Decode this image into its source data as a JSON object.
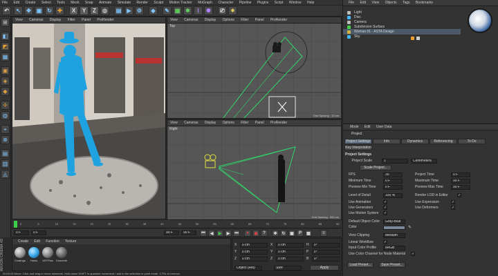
{
  "menubar": {
    "items": [
      "File",
      "Edit",
      "Create",
      "Select",
      "Tools",
      "Mesh",
      "Snap",
      "Animate",
      "Simulate",
      "Render",
      "Sculpt",
      "Motion Tracker",
      "MoGraph",
      "Character",
      "Pipeline",
      "Plugins",
      "Script",
      "Window",
      "Help"
    ]
  },
  "top_toolbar": {
    "axis_x": "X",
    "axis_y": "Y",
    "axis_z": "Z"
  },
  "viewport_left": {
    "menu": [
      "View",
      "Cameras",
      "Display",
      "Filter",
      "Panel",
      "ProRender"
    ]
  },
  "viewport_top": {
    "menu": [
      "View",
      "Cameras",
      "Display",
      "Options",
      "Filter",
      "Panel",
      "ProRender"
    ],
    "name": "Top",
    "grid_spacing": "Grid Spacing : 10 cm"
  },
  "viewport_right": {
    "menu": [
      "View",
      "Cameras",
      "Display",
      "Options",
      "Filter",
      "Panel",
      "ProRender"
    ],
    "name": "Right",
    "grid_spacing": "Grid Spacing : 500 cm"
  },
  "object_manager": {
    "menu": [
      "File",
      "Edit",
      "View",
      "Objects",
      "Tags",
      "Bookmarks"
    ],
    "objects": [
      {
        "name": "Light",
        "color": "#bbbbbb"
      },
      {
        "name": "Disc",
        "color": "#46b8ff"
      },
      {
        "name": "Camera",
        "color": "#bbbbbb"
      },
      {
        "name": "Subdivision Surface",
        "color": "#46d04a"
      },
      {
        "name": "Woman 01 - ASTA Design",
        "color": "#d0b040"
      },
      {
        "name": "Sky",
        "color": "#46b8ff"
      }
    ]
  },
  "attributes": {
    "menu": [
      "Mode",
      "Edit",
      "User Data"
    ],
    "section": "Project",
    "tabs": [
      "Project Settings",
      "Info",
      "Dynamics",
      "Referencing",
      "To Do"
    ],
    "tab2": "Key Interpolation",
    "heading": "Project Settings",
    "project_scale_label": "Project Scale",
    "project_scale_value": "1",
    "project_scale_unit": "Centimeters",
    "scale_button": "Scale Project...",
    "left_fields": [
      {
        "label": "FPS",
        "value": "30"
      },
      {
        "label": "Minimum Time",
        "value": "0 F"
      },
      {
        "label": "Preview Min Time",
        "value": "0 F"
      }
    ],
    "right_fields": [
      {
        "label": "Project Time",
        "value": "0 F"
      },
      {
        "label": "Maximum Time",
        "value": "90 F"
      },
      {
        "label": "Preview Max Time",
        "value": "90 F"
      }
    ],
    "lod_label": "Level of Detail",
    "lod_value": "100 %",
    "render_lod_label": "Render LOD in Editor",
    "checks_left": [
      "Use Animation",
      "Use Generators",
      "Use Motion System"
    ],
    "checks_right": [
      "Use Expression",
      "Use Deformers"
    ],
    "default_color_label": "Default Object Color",
    "default_color_value": "Gray-Blue",
    "color_label": "Color",
    "view_clipping_label": "View Clipping",
    "view_clipping_value": "Medium",
    "linear_workflow_label": "Linear Workflow",
    "input_color_label": "Input Color Profile",
    "input_color_value": "sRGB",
    "color_channel_label": "Use Color Channel for Node Material",
    "load_preset": "Load Preset...",
    "save_preset": "Save Preset..."
  },
  "timeline": {
    "ticks": [
      "0",
      "5",
      "10",
      "15",
      "20",
      "25",
      "30",
      "35",
      "40",
      "45",
      "50",
      "55",
      "60",
      "65",
      "70",
      "75",
      "80",
      "85",
      "90"
    ],
    "start": "0 F",
    "current": "0 F",
    "end": "90 F",
    "preview_end": "90 F"
  },
  "material_manager": {
    "menu": [
      "Create",
      "Edit",
      "Function",
      "Texture"
    ],
    "materials": [
      {
        "name": "Coatings",
        "color": "#9a9a9a"
      },
      {
        "name": "Halos",
        "color": "#3aa8e8"
      },
      {
        "name": "ASTPlas",
        "color": "#888888"
      },
      {
        "name": "Concrete",
        "color": "#6b6b6b"
      }
    ]
  },
  "coords": {
    "rows": [
      [
        "X",
        "0 cm",
        "X",
        "0 cm",
        "H",
        "0°"
      ],
      [
        "Y",
        "0 cm",
        "Y",
        "0 cm",
        "P",
        "0°"
      ],
      [
        "Z",
        "0 cm",
        "Z",
        "0 cm",
        "B",
        "0°"
      ]
    ],
    "apply": "Apply",
    "mode": "Object (Rel)",
    "size": "Size"
  },
  "status": {
    "text": "00:00:05  Move: Click and drag to move elements. Hold down SHIFT to quantize movement / add to the selection in point mode. CTRL to remove."
  },
  "brand": {
    "logo_text": "MAXON CINEMA 4D"
  },
  "colors": {
    "accent_cyan": "#1fa3e0",
    "bg": "#2b2b2b",
    "panel": "#3a3a3a",
    "camera_green": "#2fd86a",
    "timeline_marker": "#3fd04a"
  }
}
